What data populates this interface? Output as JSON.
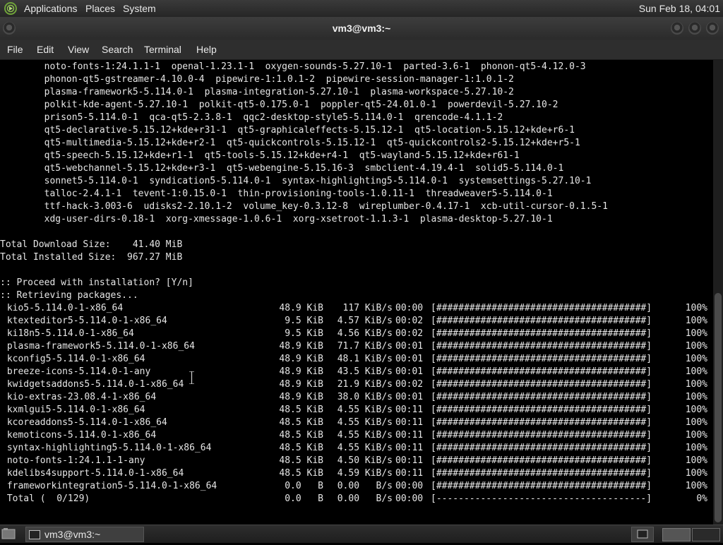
{
  "top_panel": {
    "menus": [
      "Applications",
      "Places",
      "System"
    ],
    "clock": "Sun Feb 18, 04:01"
  },
  "window": {
    "title": "vm3@vm3:~"
  },
  "menubar": [
    "File",
    "Edit",
    "View",
    "Search",
    "Terminal",
    "Help"
  ],
  "terminal": {
    "package_lines": [
      "        noto-fonts-1:24.1.1-1  openal-1.23.1-1  oxygen-sounds-5.27.10-1  parted-3.6-1  phonon-qt5-4.12.0-3",
      "        phonon-qt5-gstreamer-4.10.0-4  pipewire-1:1.0.1-2  pipewire-session-manager-1:1.0.1-2",
      "        plasma-framework5-5.114.0-1  plasma-integration-5.27.10-1  plasma-workspace-5.27.10-2",
      "        polkit-kde-agent-5.27.10-1  polkit-qt5-0.175.0-1  poppler-qt5-24.01.0-1  powerdevil-5.27.10-2",
      "        prison5-5.114.0-1  qca-qt5-2.3.8-1  qqc2-desktop-style5-5.114.0-1  qrencode-4.1.1-2",
      "        qt5-declarative-5.15.12+kde+r31-1  qt5-graphicaleffects-5.15.12-1  qt5-location-5.15.12+kde+r6-1",
      "        qt5-multimedia-5.15.12+kde+r2-1  qt5-quickcontrols-5.15.12-1  qt5-quickcontrols2-5.15.12+kde+r5-1",
      "        qt5-speech-5.15.12+kde+r1-1  qt5-tools-5.15.12+kde+r4-1  qt5-wayland-5.15.12+kde+r61-1",
      "        qt5-webchannel-5.15.12+kde+r3-1  qt5-webengine-5.15.16-3  smbclient-4.19.4-1  solid5-5.114.0-1",
      "        sonnet5-5.114.0-1  syndication5-5.114.0-1  syntax-highlighting5-5.114.0-1  systemsettings-5.27.10-1",
      "        talloc-2.4.1-1  tevent-1:0.15.0-1  thin-provisioning-tools-1.0.11-1  threadweaver5-5.114.0-1",
      "        ttf-hack-3.003-6  udisks2-2.10.1-2  volume_key-0.3.12-8  wireplumber-0.4.17-1  xcb-util-cursor-0.1.5-1",
      "        xdg-user-dirs-0.18-1  xorg-xmessage-1.0.6-1  xorg-xsetroot-1.1.3-1  plasma-desktop-5.27.10-1"
    ],
    "summary": [
      "Total Download Size:    41.40 MiB",
      "Total Installed Size:  967.27 MiB"
    ],
    "messages": [
      ":: Proceed with installation? [Y/n]",
      ":: Retrieving packages..."
    ],
    "downloads": [
      {
        "name": " kio5-5.114.0-1-x86_64",
        "size": "48.9 KiB",
        "rate": "117 KiB/s",
        "time": "00:00",
        "bar": "[######################################]",
        "pct": "100%",
        "progress": 100
      },
      {
        "name": " ktexteditor5-5.114.0-1-x86_64",
        "size": "9.5 KiB",
        "rate": "4.57 KiB/s",
        "time": "00:02",
        "bar": "[######################################]",
        "pct": "100%",
        "progress": 100
      },
      {
        "name": " ki18n5-5.114.0-1-x86_64",
        "size": "9.5 KiB",
        "rate": "4.56 KiB/s",
        "time": "00:02",
        "bar": "[######################################]",
        "pct": "100%",
        "progress": 100
      },
      {
        "name": " plasma-framework5-5.114.0-1-x86_64",
        "size": "48.9 KiB",
        "rate": "71.7 KiB/s",
        "time": "00:01",
        "bar": "[######################################]",
        "pct": "100%",
        "progress": 100
      },
      {
        "name": " kconfig5-5.114.0-1-x86_64",
        "size": "48.9 KiB",
        "rate": "48.1 KiB/s",
        "time": "00:01",
        "bar": "[######################################]",
        "pct": "100%",
        "progress": 100
      },
      {
        "name": " breeze-icons-5.114.0-1-any",
        "size": "48.9 KiB",
        "rate": "43.5 KiB/s",
        "time": "00:01",
        "bar": "[######################################]",
        "pct": "100%",
        "progress": 100
      },
      {
        "name": " kwidgetsaddons5-5.114.0-1-x86_64",
        "size": "48.9 KiB",
        "rate": "21.9 KiB/s",
        "time": "00:02",
        "bar": "[######################################]",
        "pct": "100%",
        "progress": 100
      },
      {
        "name": " kio-extras-23.08.4-1-x86_64",
        "size": "48.9 KiB",
        "rate": "38.0 KiB/s",
        "time": "00:01",
        "bar": "[######################################]",
        "pct": "100%",
        "progress": 100
      },
      {
        "name": " kxmlgui5-5.114.0-1-x86_64",
        "size": "48.5 KiB",
        "rate": "4.55 KiB/s",
        "time": "00:11",
        "bar": "[######################################]",
        "pct": "100%",
        "progress": 100
      },
      {
        "name": " kcoreaddons5-5.114.0-1-x86_64",
        "size": "48.5 KiB",
        "rate": "4.55 KiB/s",
        "time": "00:11",
        "bar": "[######################################]",
        "pct": "100%",
        "progress": 100
      },
      {
        "name": " kemoticons-5.114.0-1-x86_64",
        "size": "48.5 KiB",
        "rate": "4.55 KiB/s",
        "time": "00:11",
        "bar": "[######################################]",
        "pct": "100%",
        "progress": 100
      },
      {
        "name": " syntax-highlighting5-5.114.0-1-x86_64",
        "size": "48.5 KiB",
        "rate": "4.55 KiB/s",
        "time": "00:11",
        "bar": "[######################################]",
        "pct": "100%",
        "progress": 100
      },
      {
        "name": " noto-fonts-1:24.1.1-1-any",
        "size": "48.5 KiB",
        "rate": "4.50 KiB/s",
        "time": "00:11",
        "bar": "[######################################]",
        "pct": "100%",
        "progress": 100
      },
      {
        "name": " kdelibs4support-5.114.0-1-x86_64",
        "size": "48.5 KiB",
        "rate": "4.59 KiB/s",
        "time": "00:11",
        "bar": "[######################################]",
        "pct": "100%",
        "progress": 100
      },
      {
        "name": " frameworkintegration5-5.114.0-1-x86_64",
        "size": "0.0   B",
        "rate": "0.00   B/s",
        "time": "00:00",
        "bar": "[######################################]",
        "pct": "100%",
        "progress": 100
      },
      {
        "name": " Total (  0/129)",
        "size": "0.0   B",
        "rate": "0.00   B/s",
        "time": "00:00",
        "bar": "[--------------------------------------]",
        "pct": "0%",
        "progress": 0
      }
    ]
  },
  "taskbar": {
    "task_label": "vm3@vm3:~"
  },
  "colors": {
    "terminal_bg": "#000000",
    "terminal_fg": "#e6e6e6",
    "panel_bg": "#2e2e2e"
  }
}
